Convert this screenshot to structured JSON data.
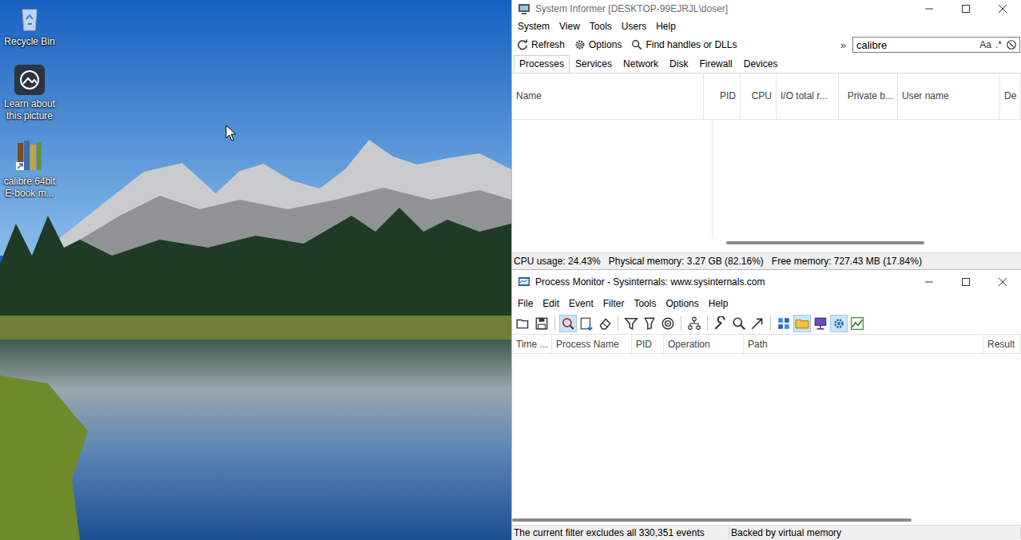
{
  "desktop": {
    "icons": [
      {
        "label": "Recycle Bin",
        "kind": "recycle"
      },
      {
        "label": "Learn about this picture",
        "kind": "learn"
      },
      {
        "label": "calibre 64bit E-book m...",
        "kind": "calibre"
      }
    ]
  },
  "system_informer": {
    "window": {
      "title": "System Informer [DESKTOP-99EJRJL\\doser]",
      "active": false
    },
    "menu": [
      "System",
      "View",
      "Tools",
      "Users",
      "Help"
    ],
    "toolbar": [
      {
        "label": "Refresh",
        "kind": "refresh"
      },
      {
        "label": "Options",
        "kind": "options"
      },
      {
        "label": "Find handles or DLLs",
        "kind": "find"
      }
    ],
    "overflow": "»",
    "search": {
      "value": "calibre",
      "case_toggle": "Aa",
      "regex_toggle": ".*"
    },
    "tabs": [
      {
        "label": "Processes",
        "selected": true
      },
      {
        "label": "Services",
        "selected": false
      },
      {
        "label": "Network",
        "selected": false
      },
      {
        "label": "Disk",
        "selected": false
      },
      {
        "label": "Firewall",
        "selected": false
      },
      {
        "label": "Devices",
        "selected": false
      }
    ],
    "columns": [
      "Name",
      "PID",
      "CPU",
      "I/O total r...",
      "Private b...",
      "User name",
      "De"
    ],
    "rows": [],
    "status_bar": [
      "CPU usage: 24.43%",
      "Physical memory: 3.27 GB (82.16%)",
      "Free memory: 727.43 MB (17.84%)"
    ]
  },
  "process_monitor": {
    "window": {
      "title": "Process Monitor - Sysinternals: www.sysinternals.com",
      "active": true
    },
    "menu": [
      "File",
      "Edit",
      "Event",
      "Filter",
      "Tools",
      "Options",
      "Help"
    ],
    "toolbar": [
      [
        {
          "kind": "open",
          "pressed": false
        },
        {
          "kind": "save",
          "pressed": false
        }
      ],
      [
        {
          "kind": "capture",
          "pressed": true
        },
        {
          "kind": "autoscroll",
          "pressed": false
        },
        {
          "kind": "clear",
          "pressed": false
        }
      ],
      [
        {
          "kind": "filter",
          "pressed": false
        },
        {
          "kind": "highlight",
          "pressed": false
        },
        {
          "kind": "target",
          "pressed": false
        }
      ],
      [
        {
          "kind": "tree",
          "pressed": false
        }
      ],
      [
        {
          "kind": "properties",
          "pressed": false
        },
        {
          "kind": "find",
          "pressed": false
        },
        {
          "kind": "jump",
          "pressed": false
        }
      ],
      [
        {
          "kind": "registry",
          "pressed": false
        },
        {
          "kind": "filesystem",
          "pressed": true
        },
        {
          "kind": "network",
          "pressed": false
        },
        {
          "kind": "process",
          "pressed": true
        },
        {
          "kind": "profiling",
          "pressed": false
        }
      ]
    ],
    "columns": [
      "Time ...",
      "Process Name",
      "PID",
      "Operation",
      "Path",
      "Result"
    ],
    "rows": [],
    "status_bar": [
      "The current filter excludes all 330,351 events",
      "Backed by virtual memory"
    ]
  }
}
